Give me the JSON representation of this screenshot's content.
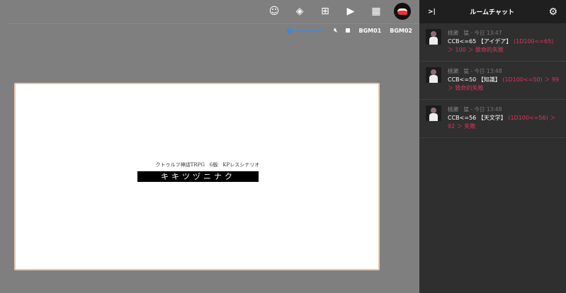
{
  "toolbar": {
    "icons": [
      "face-icon",
      "layers-icon",
      "add-comment-icon",
      "screen-icon",
      "scene-icon"
    ]
  },
  "bgm": {
    "volume": 0,
    "muted": true,
    "tracks": [
      "BGM01",
      "BGM02"
    ]
  },
  "card": {
    "subtitle": "クトゥルフ神話TRPG　6版　KPレスシナリオ",
    "title": "キキツヅニナク"
  },
  "chat": {
    "title": "ルームチャット",
    "collapse": ">|",
    "messages": [
      {
        "name": "桃瀬　猛",
        "time": "- 今日 13:47",
        "cmd": "CCB<=65 【アイデア】",
        "result": "(1D100<=65) ＞ 100 ＞ 致命的失敗"
      },
      {
        "name": "桃瀬　猛",
        "time": "- 今日 13:48",
        "cmd": "CCB<=50 【知識】",
        "result": "(1D100<=50) ＞ 99 ＞ 致命的失敗"
      },
      {
        "name": "桃瀬　猛",
        "time": "- 今日 13:48",
        "cmd": "CCB<=56 【天文学】",
        "result": "(1D100<=56) ＞ 92 ＞ 失敗"
      }
    ]
  },
  "colors": {
    "accent": "#3b86e0",
    "fail": "#e0365d"
  }
}
